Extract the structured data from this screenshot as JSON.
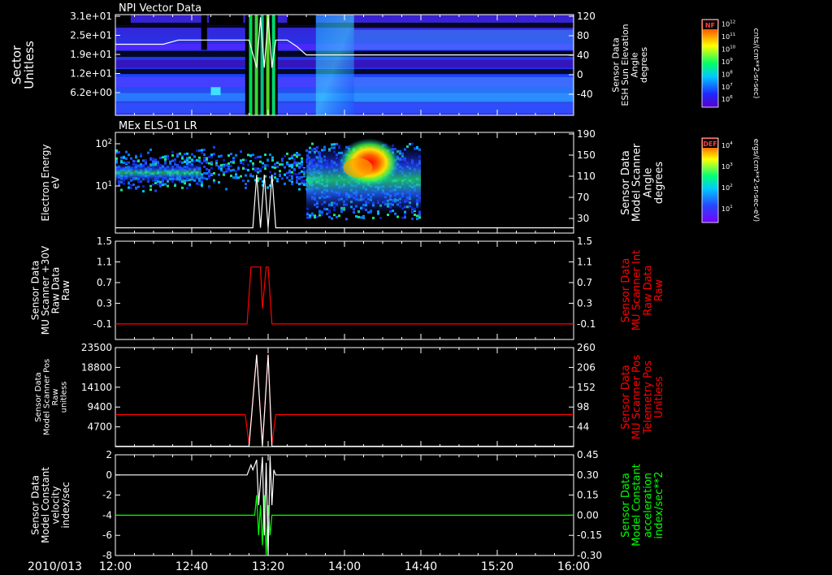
{
  "colors": {
    "background": "#000000",
    "axis": "#ffffff",
    "red_trace": "#ff0000",
    "green_trace": "#00ff00",
    "white_trace": "#ffffff"
  },
  "chart_data": [
    {
      "type": "heatmap",
      "title": "NPI Vector Data",
      "ylabel": [
        "Sector",
        "Unitless"
      ],
      "y_ticks": [
        "3.1e+01",
        "2.5e+01",
        "1.9e+01",
        "1.2e+01",
        "6.2e+00"
      ],
      "ylabel_right": [
        "Sensor Data",
        "ESH Sun Elevation",
        "Angle",
        "degrees"
      ],
      "y2_ticks": [
        "120",
        "80",
        "40",
        "0",
        "-40"
      ],
      "y2lim": [
        -70,
        120
      ],
      "colorbar": {
        "label": "NF",
        "units": "cnts/(cm**2-sr-sec)",
        "ticks": [
          "10^12",
          "10^11",
          "10^10",
          "10^9",
          "10^8",
          "10^7",
          "10^6"
        ]
      },
      "overlay_line": {
        "name": "Sensor Data ESH Sun Elevation Angle",
        "x": [
          "12:00",
          "12:15",
          "12:25",
          "12:33",
          "12:40",
          "12:50",
          "13:10",
          "13:14",
          "13:16",
          "13:18",
          "13:20",
          "13:22",
          "13:24",
          "13:30",
          "13:35",
          "13:40",
          "13:45",
          "14:00",
          "15:00",
          "16:00"
        ],
        "y": [
          64,
          64,
          64,
          72,
          72,
          72,
          72,
          20,
          115,
          20,
          115,
          20,
          72,
          72,
          60,
          44,
          44,
          44,
          44,
          44
        ]
      }
    },
    {
      "type": "heatmap",
      "title": "MEx ELS-01 LR",
      "ylabel": [
        "Electron Energy",
        "eV"
      ],
      "y_ticks": [
        "10^2",
        "10^1"
      ],
      "ylabel_right": [
        "Sensor Data",
        "Model Scanner",
        "Angle",
        "degrees"
      ],
      "y2_ticks": [
        "190",
        "150",
        "110",
        "70",
        "30"
      ],
      "y2lim": [
        0,
        190
      ],
      "colorbar": {
        "label": "DEF",
        "units": "ergs/(cm**2-sr-sec-eV)",
        "ticks": [
          "10^4",
          "10^3",
          "10^2",
          "10^1"
        ]
      },
      "overlay_line": {
        "name": "Sensor Data Model Scanner Angle",
        "x": [
          "12:00",
          "13:10",
          "13:12",
          "13:14",
          "13:16",
          "13:18",
          "13:20",
          "13:22",
          "13:24",
          "16:00"
        ],
        "y": [
          10,
          10,
          10,
          110,
          10,
          110,
          10,
          110,
          10,
          10
        ]
      }
    },
    {
      "type": "line",
      "ylabel": [
        "Sensor Data",
        "MU Scanner +30V",
        "Raw Data",
        "Raw"
      ],
      "y_ticks": [
        "1.5",
        "1.1",
        "0.7",
        "0.3",
        "-0.1"
      ],
      "ylim": [
        -0.4,
        1.5
      ],
      "ylabel_right": [
        "Sensor Data",
        "MU Scanner Int",
        "Raw Data",
        "Raw"
      ],
      "y2_ticks": [
        "1.5",
        "1.1",
        "0.7",
        "0.3",
        "-0.1"
      ],
      "series": [
        {
          "name": "Sensor Data MU Scanner Int Raw Data",
          "x": [
            "12:00",
            "13:09",
            "13:11",
            "13:16",
            "13:17",
            "13:19",
            "13:20",
            "13:22",
            "13:23",
            "16:00"
          ],
          "y": [
            -0.1,
            -0.1,
            1.0,
            1.0,
            0.2,
            1.0,
            1.0,
            -0.1,
            -0.1,
            -0.1
          ]
        }
      ]
    },
    {
      "type": "line",
      "ylabel": [
        "Sensor Data",
        "Model Scanner Pos",
        "Raw",
        "unitless"
      ],
      "y_ticks": [
        "23500",
        "18800",
        "14100",
        "9400",
        "4700"
      ],
      "ylim": [
        0,
        23500
      ],
      "ylabel_right": [
        "Sensor Data",
        "MU Scanner Pos",
        "Telemetry Pos",
        "Unitless"
      ],
      "y2_ticks": [
        "260",
        "206",
        "152",
        "98",
        "44"
      ],
      "series": [
        {
          "name": "Sensor Data MU Scanner Pos Telemetry Pos",
          "x": [
            "12:00",
            "13:08",
            "13:10",
            "13:14",
            "13:17",
            "13:20",
            "13:22",
            "13:24",
            "16:00"
          ],
          "y": [
            7600,
            7600,
            600,
            21800,
            600,
            21800,
            600,
            7600,
            7600
          ]
        },
        {
          "name": "Sensor Data Model Scanner Pos Raw",
          "x": [
            "12:00",
            "13:10",
            "13:14",
            "13:17",
            "13:20",
            "13:22",
            "16:00"
          ],
          "y": [
            100,
            100,
            21800,
            100,
            21800,
            100,
            100
          ]
        }
      ]
    },
    {
      "type": "line",
      "ylabel": [
        "Sensor Data",
        "Model Constant",
        "velocity",
        "index/sec"
      ],
      "y_ticks": [
        "2",
        "0",
        "-2",
        "-4",
        "-6",
        "-8"
      ],
      "ylim": [
        -8,
        2
      ],
      "ylabel_right": [
        "Sensor Data",
        "Model Constant",
        "acceleration",
        "index/sec**2"
      ],
      "y2_ticks": [
        "0.45",
        "0.30",
        "0.15",
        "0.00",
        "-0.15",
        "-0.30"
      ],
      "series": [
        {
          "name": "Sensor Data Model Constant acceleration",
          "x": [
            "12:00",
            "13:13",
            "13:14",
            "13:15",
            "13:16",
            "13:17",
            "13:18",
            "13:19",
            "13:20",
            "13:21",
            "13:22",
            "13:23",
            "16:00"
          ],
          "y": [
            -4,
            -4,
            -2,
            -6,
            -3,
            -7,
            -2,
            -8,
            -3,
            -6,
            -4,
            -4,
            -4
          ]
        },
        {
          "name": "Sensor Data Model Constant velocity",
          "x": [
            "12:00",
            "13:09",
            "13:11",
            "13:12",
            "13:14",
            "13:15",
            "13:17",
            "13:18",
            "13:19",
            "13:20",
            "13:21",
            "13:22",
            "13:23",
            "13:24",
            "16:00"
          ],
          "y": [
            0,
            0,
            1,
            0.5,
            1.5,
            -3,
            1.8,
            -6,
            1.2,
            -8,
            1.9,
            -3,
            0.5,
            0,
            0
          ]
        }
      ]
    }
  ],
  "x_axis": {
    "date_label": "2010/013",
    "ticks": [
      "12:00",
      "12:40",
      "13:20",
      "14:00",
      "14:40",
      "15:20",
      "16:00"
    ],
    "xlim": [
      "12:00",
      "16:00"
    ]
  }
}
